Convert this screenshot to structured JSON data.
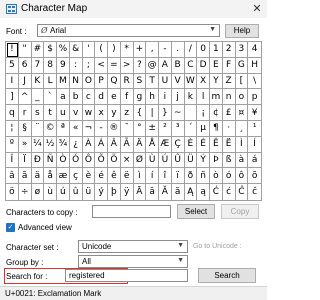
{
  "window": {
    "title": "Character Map",
    "close_glyph": "✕"
  },
  "font": {
    "label": "Font :",
    "value": "Arial",
    "icon": "Ø",
    "help_label": "Help"
  },
  "grid": {
    "rows": [
      [
        "!",
        "\"",
        "#",
        "$",
        "%",
        "&",
        "'",
        "(",
        ")",
        "*",
        "+",
        ",",
        "-",
        ".",
        "/",
        "0",
        "1",
        "2",
        "3",
        "4"
      ],
      [
        "5",
        "6",
        "7",
        "8",
        "9",
        ":",
        ";",
        "<",
        "=",
        ">",
        "?",
        "@",
        "A",
        "B",
        "C",
        "D",
        "E",
        "F",
        "G",
        "H"
      ],
      [
        "I",
        "J",
        "K",
        "L",
        "M",
        "N",
        "O",
        "P",
        "Q",
        "R",
        "S",
        "T",
        "U",
        "V",
        "W",
        "X",
        "Y",
        "Z",
        "[",
        "\\"
      ],
      [
        "]",
        "^",
        "_",
        "`",
        "a",
        "b",
        "c",
        "d",
        "e",
        "f",
        "g",
        "h",
        "i",
        "j",
        "k",
        "l",
        "m",
        "n",
        "o",
        "p"
      ],
      [
        "q",
        "r",
        "s",
        "t",
        "u",
        "v",
        "w",
        "x",
        "y",
        "z",
        "{",
        "|",
        "}",
        "~",
        " ",
        "¡",
        "¢",
        "£",
        "¤",
        "¥"
      ],
      [
        "¦",
        "§",
        "¨",
        "©",
        "ª",
        "«",
        "¬",
        "-",
        "®",
        "¯",
        "°",
        "±",
        "²",
        "³",
        "´",
        "µ",
        "¶",
        "·",
        "¸",
        "¹"
      ],
      [
        "º",
        "»",
        "¼",
        "½",
        "¾",
        "¿",
        "À",
        "Á",
        "Â",
        "Ã",
        "Ä",
        "Å",
        "Æ",
        "Ç",
        "È",
        "É",
        "Ê",
        "Ë",
        "Ì",
        "Í"
      ],
      [
        "Î",
        "Ï",
        "Ð",
        "Ñ",
        "Ò",
        "Ó",
        "Ô",
        "Õ",
        "Ö",
        "×",
        "Ø",
        "Ù",
        "Ú",
        "Û",
        "Ü",
        "Ý",
        "Þ",
        "ß",
        "à",
        "á"
      ],
      [
        "â",
        "ã",
        "ä",
        "å",
        "æ",
        "ç",
        "è",
        "é",
        "ê",
        "ë",
        "ì",
        "í",
        "î",
        "ï",
        "ð",
        "ñ",
        "ò",
        "ó",
        "ô",
        "õ"
      ],
      [
        "ö",
        "÷",
        "ø",
        "ù",
        "ú",
        "û",
        "ü",
        "ý",
        "þ",
        "ÿ",
        "Ā",
        "ā",
        "Ă",
        "ă",
        "Ą",
        "ą",
        "Ć",
        "ć",
        "Ĉ",
        "ĉ"
      ]
    ],
    "selected_index": 0
  },
  "copy": {
    "label": "Characters to copy :",
    "value": "",
    "select_label": "Select",
    "copy_label": "Copy"
  },
  "advanced": {
    "label": "Advanced view",
    "checked": true,
    "check_glyph": "✓"
  },
  "charset": {
    "label": "Character set :",
    "value": "Unicode",
    "goto_label": "Go to Unicode :"
  },
  "groupby": {
    "label": "Group by :",
    "value": "All"
  },
  "search": {
    "label": "Search for :",
    "value": "registered",
    "button_label": "Search",
    "highlight_color": "#e0322b"
  },
  "status": {
    "text": "U+0021: Exclamation Mark"
  }
}
